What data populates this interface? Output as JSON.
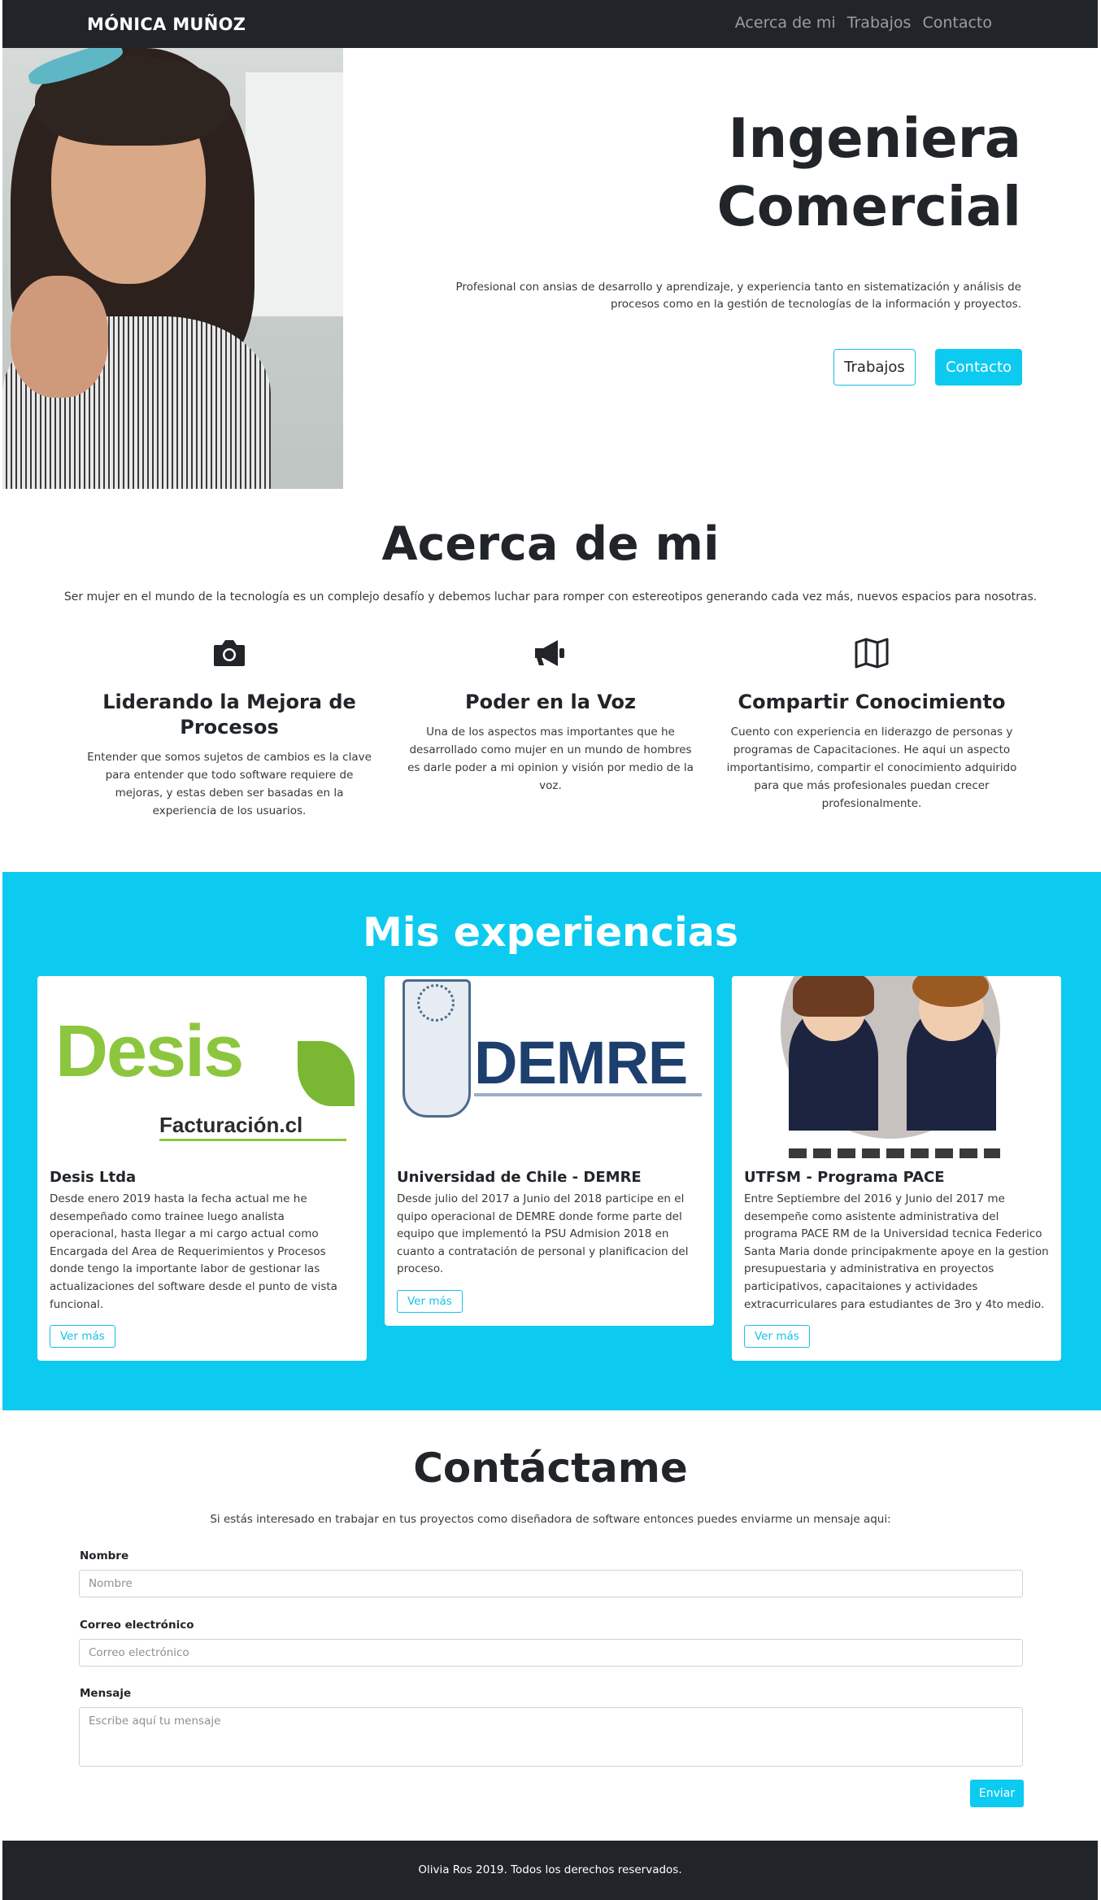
{
  "navbar": {
    "brand": "MÓNICA MUÑOZ",
    "links": [
      "Acerca de mi",
      "Trabajos",
      "Contacto"
    ]
  },
  "hero": {
    "title": "Ingeniera Comercial",
    "description": "Profesional con ansias de desarrollo y aprendizaje, y experiencia tanto en sistematización y análisis de procesos como en la gestión de tecnologías de la información y proyectos.",
    "button_works": "Trabajos",
    "button_contact": "Contacto"
  },
  "about": {
    "title": "Acerca de mi",
    "subtitle": "Ser mujer en el mundo de la tecnología es un complejo desafío y debemos luchar para romper con estereotipos generando cada vez más, nuevos espacios para nosotras.",
    "features": [
      {
        "icon": "camera-icon",
        "title": "Liderando la Mejora de Procesos",
        "text": "Entender que somos sujetos de cambios es la clave para entender que todo software requiere de mejoras, y estas deben ser basadas en la experiencia de los usuarios."
      },
      {
        "icon": "megaphone-icon",
        "title": "Poder en la Voz",
        "text": "Una de los aspectos mas importantes que he desarrollado como mujer en un mundo de hombres es darle poder a mi opinion y visión por medio de la voz."
      },
      {
        "icon": "map-icon",
        "title": "Compartir Conocimiento",
        "text": "Cuento con experiencia en liderazgo de personas y programas de Capacitaciones. He aqui un aspecto importantisimo, compartir el conocimiento adquirido para que más profesionales puedan crecer profesionalmente."
      }
    ]
  },
  "experiences": {
    "title": "Mis experiencias",
    "cards": [
      {
        "logo_text": "Desis",
        "logo_sub": "Facturación.cl",
        "title": "Desis Ltda",
        "text": "Desde enero 2019 hasta la fecha actual me he desempeñado como trainee luego analista operacional, hasta llegar a mi cargo actual como Encargada del Area de Requerimientos y Procesos donde tengo la importante labor de gestionar las actualizaciones del software desde el punto de vista funcional.",
        "button": "Ver más"
      },
      {
        "logo_text": "DEMRE",
        "title": "Universidad de Chile - DEMRE",
        "text": "Desde julio del 2017 a Junio del 2018 participe en el quipo operacional de DEMRE donde forme parte del equipo que implementó la PSU Admision 2018 en cuanto a contratación de personal y planificacion del proceso.",
        "button": "Ver más"
      },
      {
        "title": "UTFSM - Programa PACE",
        "text": "Entre Septiembre del 2016 y Junio del 2017 me desempeñe como asistente administrativa del programa PACE RM de la Universidad tecnica Federico Santa Maria donde principakmente apoye en la gestion presupuestaria y administrativa en proyectos participativos, capacitaiones y actividades extracurriculares para estudiantes de 3ro y 4to medio.",
        "button": "Ver más"
      }
    ]
  },
  "contact": {
    "title": "Contáctame",
    "subtitle": "Si estás interesado en trabajar en tus proyectos como diseñadora de software entonces puedes enviarme un mensaje aqui:",
    "name_label": "Nombre",
    "name_placeholder": "Nombre",
    "email_label": "Correo electrónico",
    "email_placeholder": "Correo electrónico",
    "message_label": "Mensaje",
    "message_placeholder": "Escribe aquí tu mensaje",
    "submit": "Enviar"
  },
  "footer": {
    "text": "Olivia Ros 2019. Todos los derechos reservados."
  },
  "colors": {
    "accent": "#0dcaf0",
    "dark": "#212529"
  }
}
